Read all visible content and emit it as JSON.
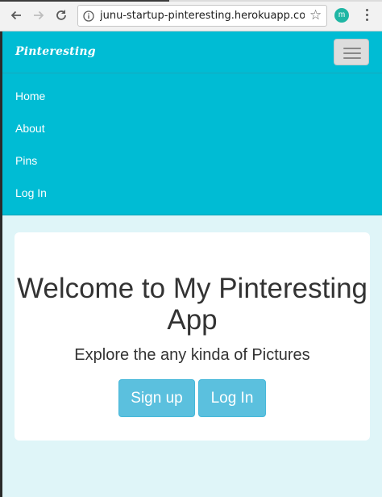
{
  "browser": {
    "url": "junu-startup-pinteresting.herokuapp.com",
    "extension_label": "m",
    "icons": {
      "back": "back-arrow-icon",
      "forward": "forward-arrow-icon",
      "reload": "reload-icon",
      "info": "info-icon",
      "star": "star-icon",
      "menu": "kebab-menu-icon"
    }
  },
  "navbar": {
    "brand": "Pinteresting",
    "links": [
      "Home",
      "About",
      "Pins",
      "Log In"
    ],
    "color": "#00bcd4"
  },
  "jumbotron": {
    "title": "Welcome to My Pinteresting App",
    "subtitle": "Explore the any kinda of Pictures",
    "signup_label": "Sign up",
    "login_label": "Log In",
    "button_color": "#5bc0de"
  }
}
